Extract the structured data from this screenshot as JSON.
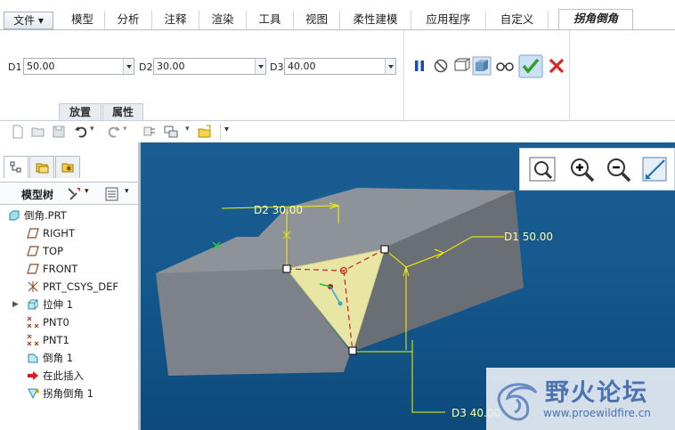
{
  "ribbon_tabs": [
    "文件",
    "模型",
    "分析",
    "注释",
    "渲染",
    "工具",
    "视图",
    "柔性建模",
    "应用程序",
    "自定义",
    "拐角倒角"
  ],
  "dims": [
    {
      "label": "D1",
      "value": "50.00"
    },
    {
      "label": "D2",
      "value": "30.00"
    },
    {
      "label": "D3",
      "value": "40.00"
    }
  ],
  "subtabs": {
    "placement": "放置",
    "properties": "属性"
  },
  "model_tree_label": "模型树",
  "tree": [
    {
      "label": "倒角.PRT",
      "icon": "part-icon"
    },
    {
      "label": "RIGHT",
      "icon": "datum-plane-icon"
    },
    {
      "label": "TOP",
      "icon": "datum-plane-icon"
    },
    {
      "label": "FRONT",
      "icon": "datum-plane-icon"
    },
    {
      "label": "PRT_CSYS_DEF",
      "icon": "csys-icon"
    },
    {
      "label": "拉伸 1",
      "icon": "extrude-icon"
    },
    {
      "label": "PNT0",
      "icon": "datum-point-icon"
    },
    {
      "label": "PNT1",
      "icon": "datum-point-icon"
    },
    {
      "label": "倒角 1",
      "icon": "chamfer-icon"
    },
    {
      "label": "在此插入",
      "icon": "insert-arrow-icon"
    },
    {
      "label": "拐角倒角 1",
      "icon": "corner-chamfer-icon"
    }
  ],
  "viewport_annotations": {
    "d1": "D1 50.00",
    "d2": "D2 30.00",
    "d3": "D3 40.00"
  },
  "watermark": {
    "title": "野火论坛",
    "url": "www.proewildfire.cn"
  },
  "colors": {
    "viewport_bg": "#155a8f",
    "dim_yellow": "#ffffa0",
    "accept_green": "#3aa53a",
    "cancel_red": "#d8282b",
    "model_gray": "#9aa0a8"
  }
}
